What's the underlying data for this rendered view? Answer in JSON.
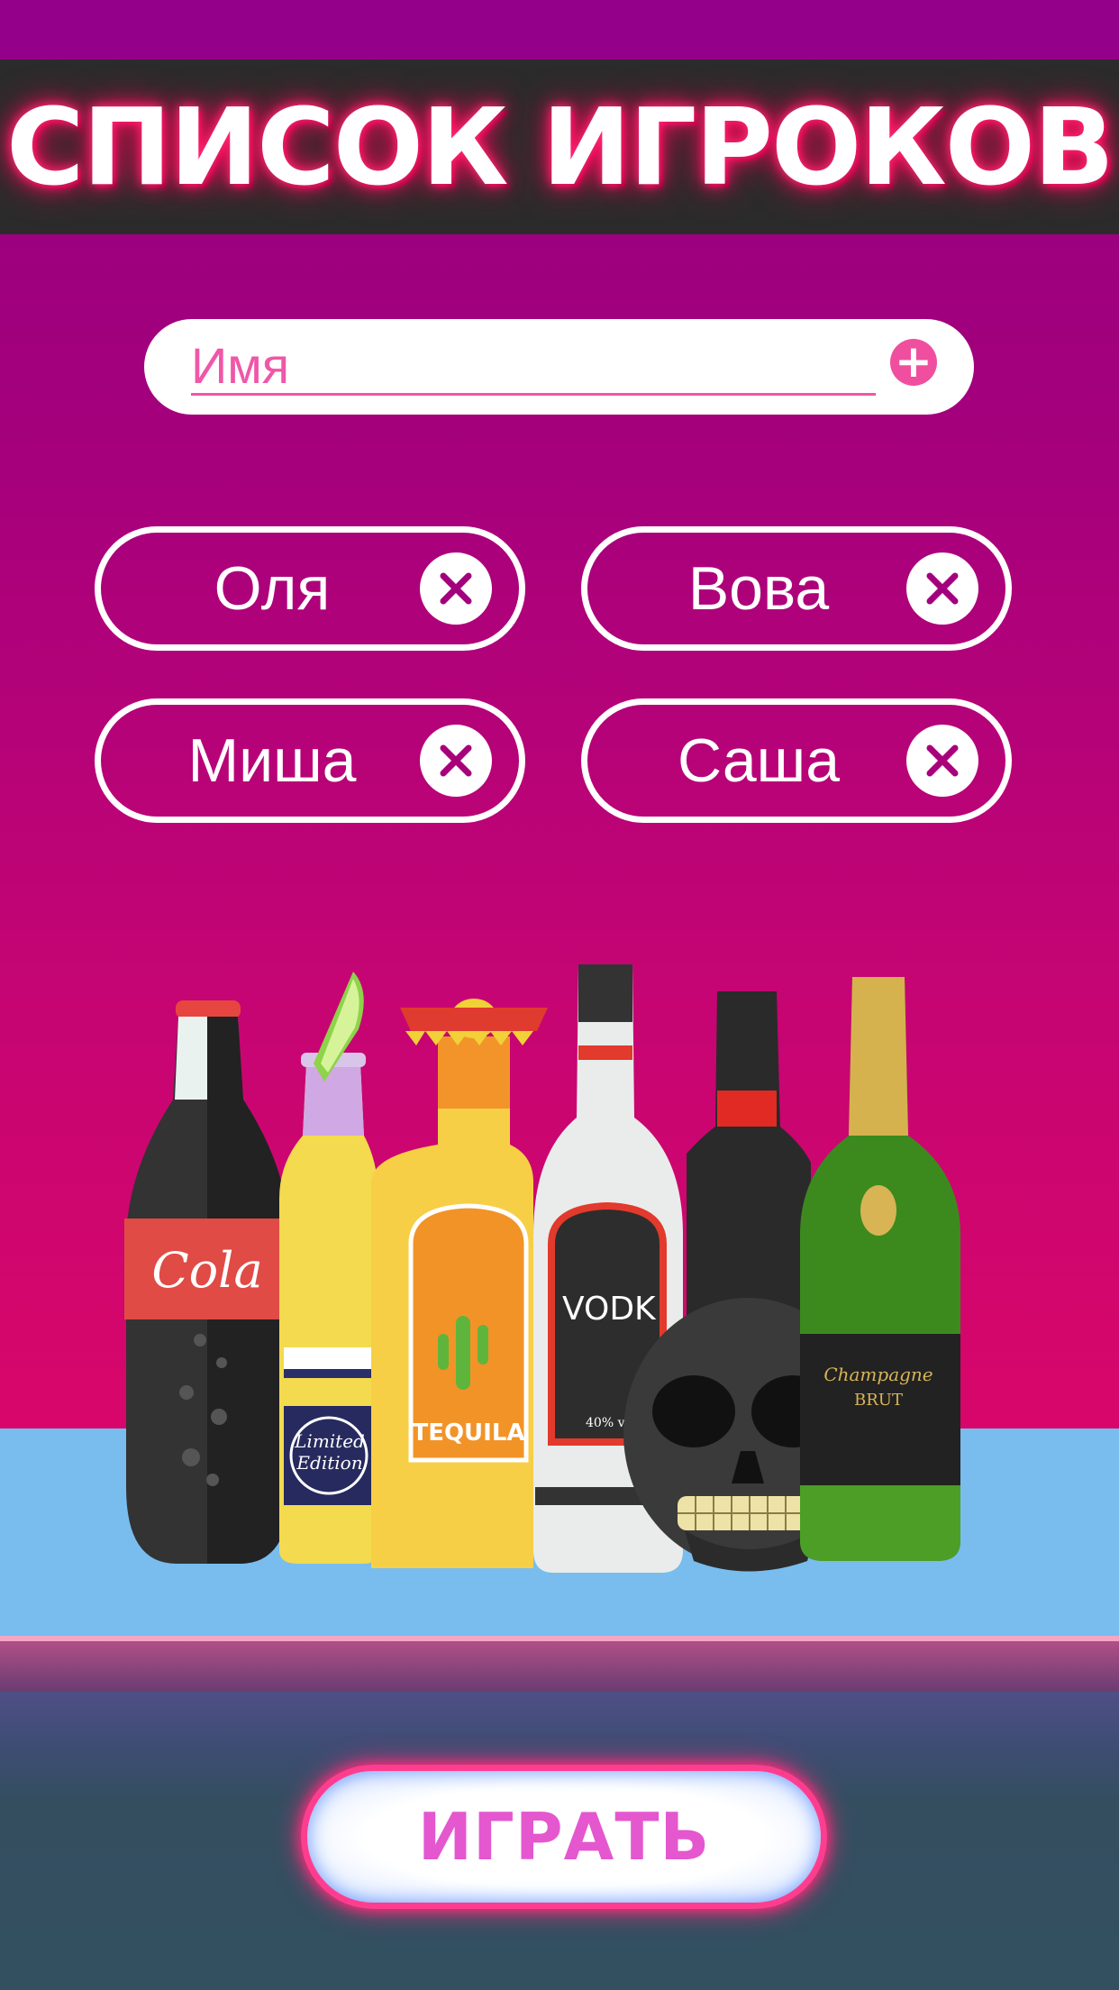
{
  "header": {
    "title": "СПИСОК ИГРОКОВ"
  },
  "name_field": {
    "placeholder": "Имя",
    "add_icon": "plus-circle-icon"
  },
  "players": [
    {
      "name": "Оля"
    },
    {
      "name": "Вова"
    },
    {
      "name": "Миша"
    },
    {
      "name": "Саша"
    }
  ],
  "remove_icon": "close-icon",
  "illustration": {
    "cola_label": "Cola",
    "beer_label_line1": "Limited",
    "beer_label_line2": "Edition",
    "tequila_label": "TEQUILA",
    "vodka_label": "VODK",
    "vodka_abv": "40% vol",
    "champagne_label_line1": "Champagne",
    "champagne_label_line2": "BRUT"
  },
  "play_button": {
    "label": "ИГРАТЬ"
  },
  "colors": {
    "background_top": "#93007f",
    "background_bottom": "#d8066a",
    "header_bar": "#2b2b2b",
    "accent_pink": "#ef57a8",
    "counter": "#78bdee",
    "footer": "#325060"
  }
}
